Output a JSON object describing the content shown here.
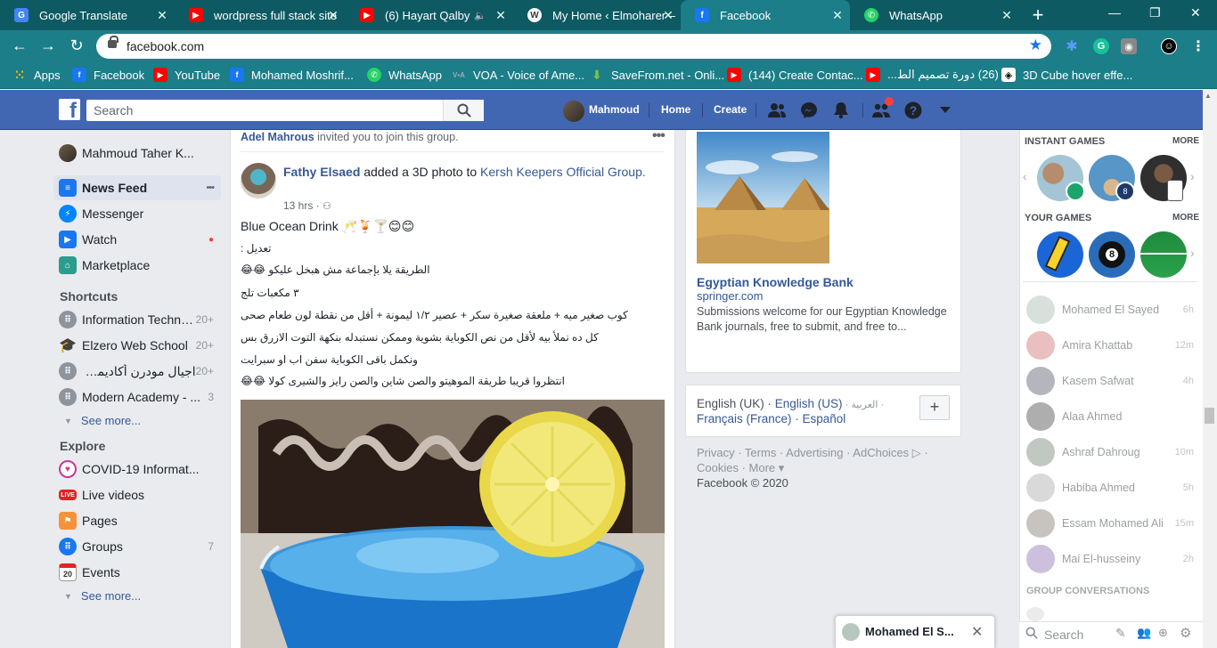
{
  "browser": {
    "tabs": [
      {
        "title": "Google Translate",
        "favicon": "G",
        "color": "#4285f4"
      },
      {
        "title": "wordpress full stack site",
        "favicon": "▶",
        "color": "#ff0000"
      },
      {
        "title": "(6) Hayart Qalby M",
        "favicon": "▶",
        "color": "#ff0000"
      },
      {
        "title": "My Home ‹ Elmoharer –",
        "favicon": "W",
        "color": "#3c3c3c"
      },
      {
        "title": "Facebook",
        "favicon": "f",
        "color": "#1877f2"
      },
      {
        "title": "WhatsApp",
        "favicon": "✆",
        "color": "#25d366"
      }
    ],
    "url": "facebook.com",
    "bookmarks": [
      {
        "label": "Apps",
        "icon": "apps-grid-icon",
        "color": "#e94235"
      },
      {
        "label": "Facebook",
        "icon": "facebook-icon",
        "color": "#1877f2"
      },
      {
        "label": "YouTube",
        "icon": "youtube-icon",
        "color": "#ff0000"
      },
      {
        "label": "Mohamed Moshrif...",
        "icon": "facebook-icon",
        "color": "#1877f2"
      },
      {
        "label": "WhatsApp",
        "icon": "whatsapp-icon",
        "color": "#25d366"
      },
      {
        "label": "VOA - Voice of Ame...",
        "icon": "voa-icon",
        "color": "#1e5aa8"
      },
      {
        "label": "SaveFrom.net - Onli...",
        "icon": "download-icon",
        "color": "#7cc242"
      },
      {
        "label": "(144) Create Contac...",
        "icon": "youtube-icon",
        "color": "#ff0000"
      },
      {
        "label": "(26) دورة تصميم الط...",
        "icon": "youtube-icon",
        "color": "#ff0000"
      },
      {
        "label": "3D Cube hover effe...",
        "icon": "codepen-icon",
        "color": "#000000"
      }
    ]
  },
  "fb": {
    "search_placeholder": "Search",
    "user_name": "Mahmoud",
    "nav_home": "Home",
    "nav_create": "Create"
  },
  "left": {
    "profile": "Mahmoud Taher K...",
    "items": [
      {
        "label": "News Feed",
        "color": "#1877f2",
        "extra": "•••"
      },
      {
        "label": "Messenger",
        "color": "#0084ff",
        "extra": ""
      },
      {
        "label": "Watch",
        "color": "#1877f2",
        "extra": "●"
      },
      {
        "label": "Marketplace",
        "color": "#2a9d8f",
        "extra": ""
      }
    ],
    "shortcuts_title": "Shortcuts",
    "shortcuts": [
      {
        "label": "Information Techno...",
        "count": "20+"
      },
      {
        "label": "Elzero Web School",
        "count": "20+"
      },
      {
        "label": "اجيال مودرن أكاديمي - s...",
        "count": "20+"
      },
      {
        "label": "Modern Academy - ...",
        "count": "3"
      }
    ],
    "see_more": "See more...",
    "explore_title": "Explore",
    "explore": [
      {
        "label": "COVID-19 Informat...",
        "count": ""
      },
      {
        "label": "Live videos",
        "count": ""
      },
      {
        "label": "Pages",
        "count": ""
      },
      {
        "label": "Groups",
        "count": "7"
      },
      {
        "label": "Events",
        "count": ""
      }
    ],
    "see_more2": "See more..."
  },
  "feed": {
    "invite_name": "Adel Mahrous",
    "invite_text": " invited you to join this group.",
    "post_author": "Fathy Elsaed",
    "post_action": " added a 3D photo to ",
    "post_group": "Kersh Keepers Official Group.",
    "post_time": "13 hrs · ",
    "post_title": "Blue Ocean Drink 🥂🍹🍸😊😊",
    "lines": [
      "تعديل :",
      "الطريقة يلا بإجماعة مش هبخل عليكو 😂😂",
      "٣ مكعبات تلج",
      "كوب صغير ميه + ملعقة صغيرة سكر + عصير ١/٢ ليمونة + أقل من نقطة لون طعام صحى",
      "كل ده نملأ بيه لأقل من نص الكوباية بشوية وممكن نستبدله بنكهة التوت الازرق بس",
      "ونكمل باقى الكوباية سفن اب او سبرايت",
      "انتظروا قريبا طريقة الموهيتو والصن شاين والصن رايز والشيرى كولا 😂😂"
    ]
  },
  "right": {
    "ad_title": "Egyptian Knowledge Bank",
    "ad_domain": "springer.com",
    "ad_desc": "Submissions welcome for our Egyptian Knowledge Bank journals, free to submit, and free to...",
    "langs_line1": "English (UK) · ",
    "lang_current": "English (US)",
    "lang_ar": " · العربية ·",
    "langs_line2": "Français (France) · Español",
    "footer_line1": "Privacy · Terms · Advertising · AdChoices ▷ ·",
    "footer_line2": "Cookies · More ▾",
    "copyright": "Facebook © 2020"
  },
  "chat": {
    "instant_games": "INSTANT GAMES",
    "your_games": "YOUR GAMES",
    "more": "MORE",
    "contacts": [
      {
        "name": "Mohamed El Sayed",
        "time": "6h"
      },
      {
        "name": "Amira Khattab",
        "time": "12m"
      },
      {
        "name": "Kasem Safwat",
        "time": "4h"
      },
      {
        "name": "Alaa Ahmed",
        "time": ""
      },
      {
        "name": "Ashraf Dahroug",
        "time": "10m"
      },
      {
        "name": "Habiba Ahmed",
        "time": "5h"
      },
      {
        "name": "Essam Mohamed Ali",
        "time": "15m"
      },
      {
        "name": "Mai El-husseiny",
        "time": "2h"
      }
    ],
    "group_conversations": "GROUP CONVERSATIONS",
    "search_placeholder": "Search",
    "popup_name": "Mohamed El S..."
  }
}
